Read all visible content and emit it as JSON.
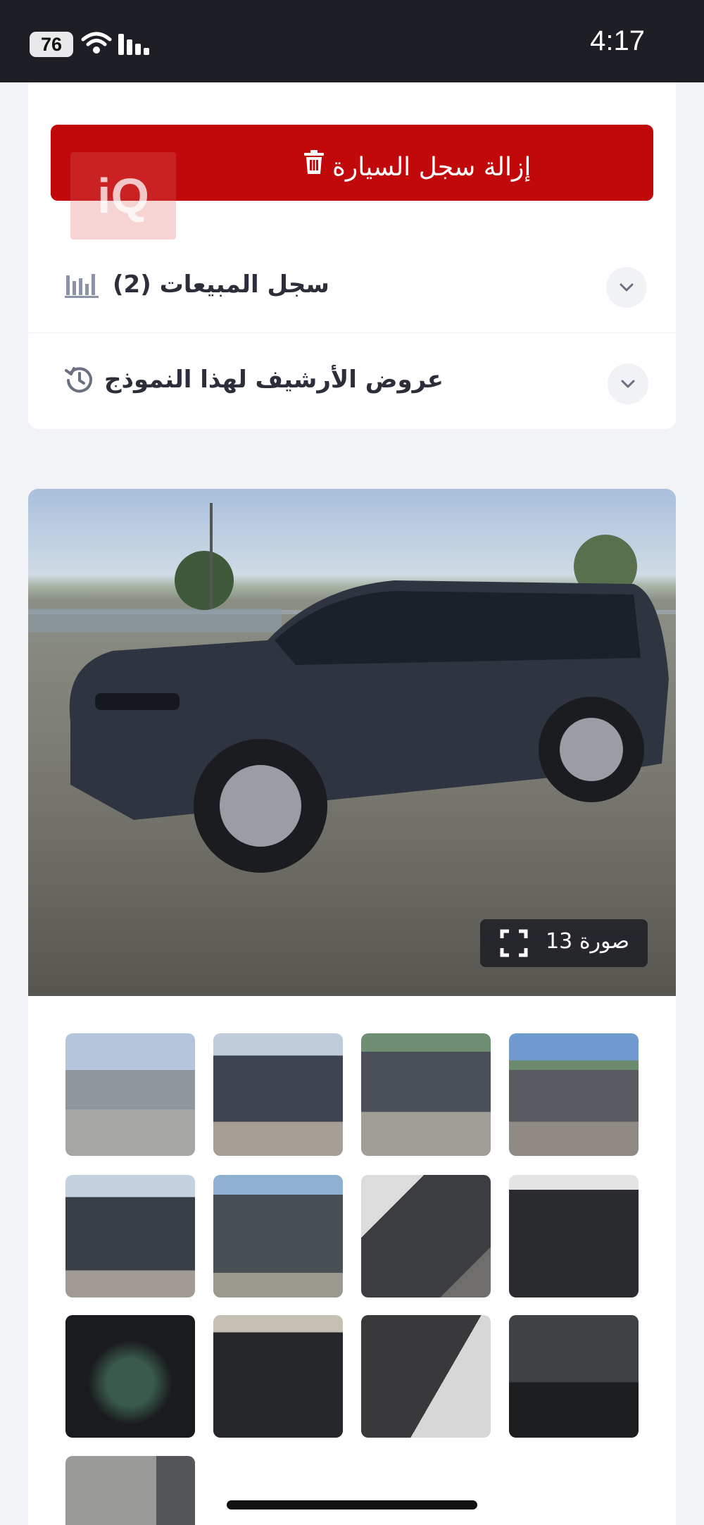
{
  "status_bar": {
    "battery": "76",
    "time": "4:17"
  },
  "actions": {
    "remove_car_record": "إزالة سجل السيارة"
  },
  "watermark": {
    "logo_text": "iQ"
  },
  "sections": [
    {
      "title": "سجل المبيعات (2)",
      "icon": "bar-chart-icon"
    },
    {
      "title": "عروض الأرشيف لهذا النموذج",
      "icon": "history-icon"
    }
  ],
  "gallery": {
    "photo_count_label": "صورة 13",
    "thumbnails": [
      "front-left view",
      "rear-left view",
      "left side view",
      "right side view",
      "front view",
      "rear view",
      "front seats",
      "dashboard",
      "instrument cluster",
      "rear seats",
      "rear side seats",
      "engine bay",
      "door label"
    ]
  },
  "colors": {
    "accent_red": "#c1080a",
    "status_bar": "#1e1f24",
    "background": "#f2f3f7"
  }
}
